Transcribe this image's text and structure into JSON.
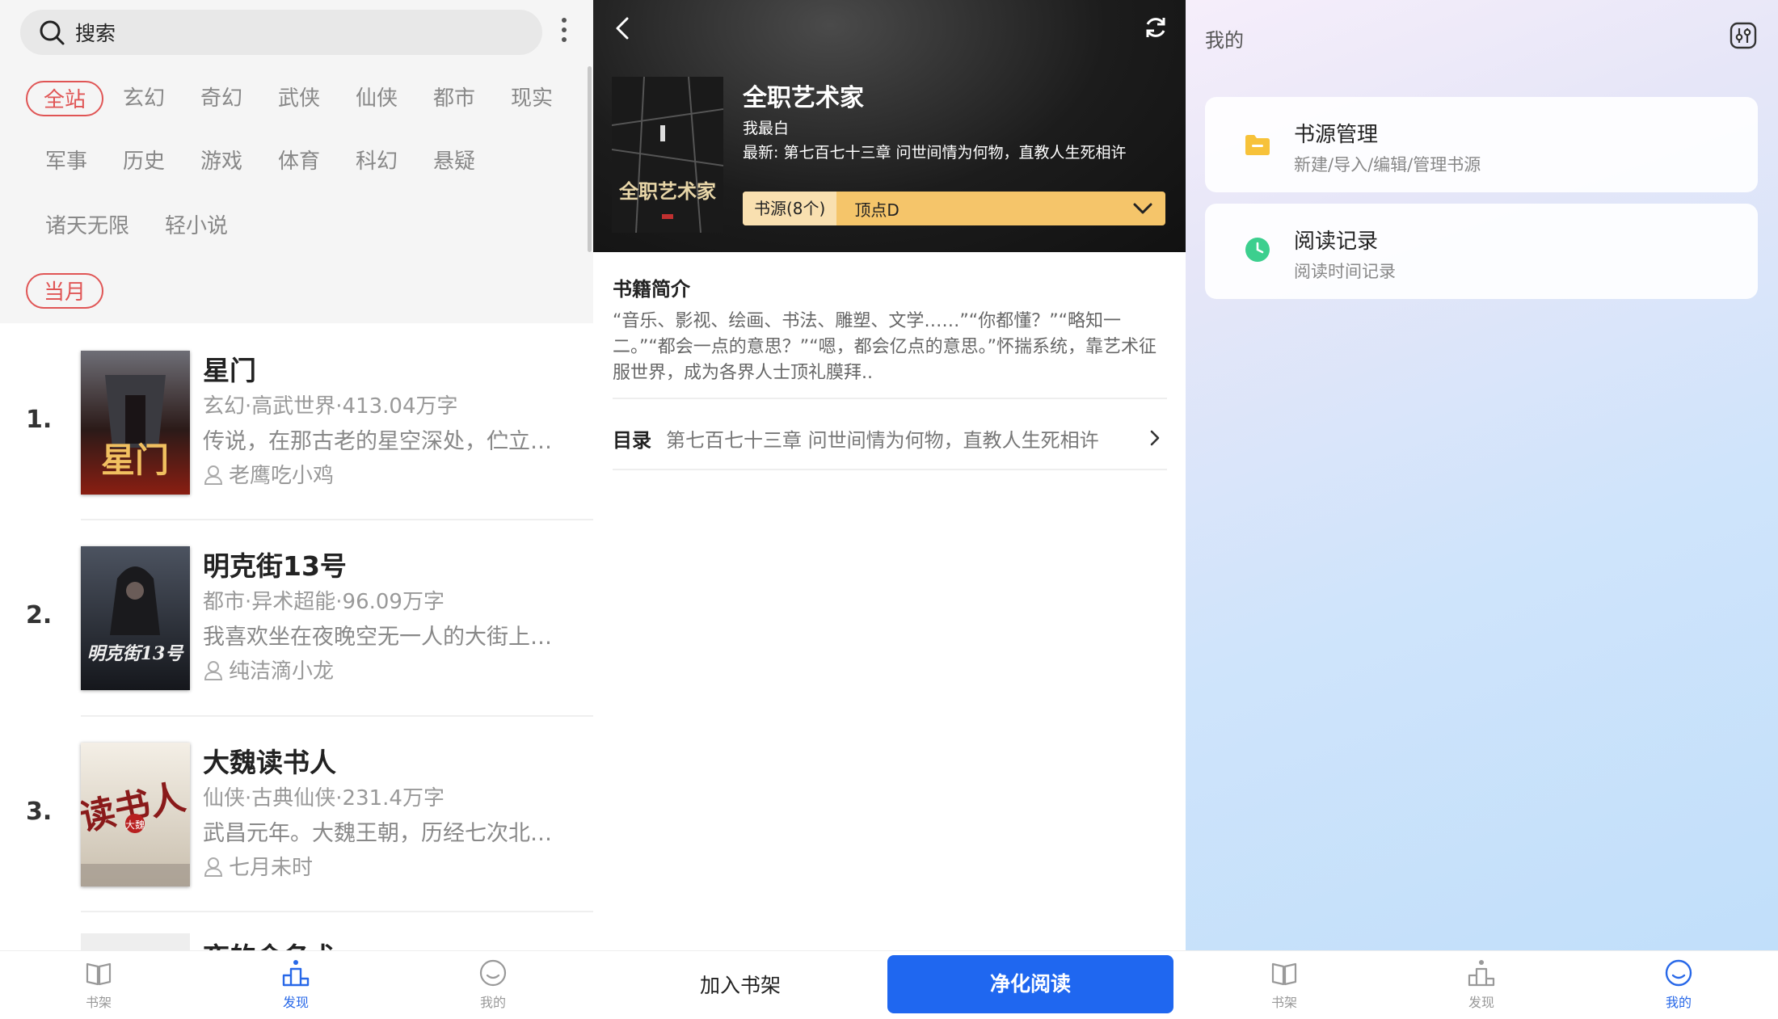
{
  "discover": {
    "search_label": "搜索",
    "categories_row1": [
      "全站",
      "玄幻",
      "奇幻",
      "武侠",
      "仙侠",
      "都市",
      "现实"
    ],
    "categories_row2": [
      "军事",
      "历史",
      "游戏",
      "体育",
      "科幻",
      "悬疑"
    ],
    "categories_row3": [
      "诸天无限",
      "轻小说"
    ],
    "period": "当月",
    "books": [
      {
        "rank": "1.",
        "title": "星门",
        "meta": "玄幻·高武世界·413.04万字",
        "desc": "传说，在那古老的星空深处，伫立…",
        "author": "老鹰吃小鸡"
      },
      {
        "rank": "2.",
        "title": "明克街13号",
        "meta": "都市·异术超能·96.09万字",
        "desc": "我喜欢坐在夜晚空无一人的大街上…",
        "author": "纯洁滴小龙"
      },
      {
        "rank": "3.",
        "title": "大魏读书人",
        "meta": "仙侠·古典仙侠·231.4万字",
        "desc": "武昌元年。大魏王朝，历经七次北…",
        "author": "七月未时"
      }
    ],
    "partial_title": "夜的命名术",
    "cover_texts": {
      "b1": "星门",
      "b2": "明克街13号",
      "b3": "读书人",
      "b3b": "大魏"
    }
  },
  "detail": {
    "title": "全职艺术家",
    "author": "我最白",
    "latest": "最新: 第七百七十三章 问世间情为何物，直教人生死相许",
    "cover_text": "全职艺术家",
    "source_count": "书源(8个)",
    "source_name": "顶点D",
    "intro_title": "书籍简介",
    "intro": "“音乐、影视、绘画、书法、雕塑、文学……”“你都懂？”“略知一二。”“都会一点的意思？”“嗯，都会亿点的意思。”怀揣系统，靠艺术征服世界，成为各界人士顶礼膜拜..",
    "toc_label": "目录",
    "toc_chapter": "第七百七十三章 问世间情为何物，直教人生死相许",
    "add_shelf": "加入书架",
    "pure_read": "净化阅读"
  },
  "mine": {
    "title": "我的",
    "cards": [
      {
        "title": "书源管理",
        "desc": "新建/导入/编辑/管理书源",
        "icon": "folder-icon",
        "color": "#f7c23a"
      },
      {
        "title": "阅读记录",
        "desc": "阅读时间记录",
        "icon": "clock-icon",
        "color": "#3ccf8e"
      }
    ]
  },
  "nav": {
    "shelf": "书架",
    "discover": "发现",
    "mine": "我的"
  },
  "colors": {
    "accent": "#2868e8",
    "category_selected": "#e05555",
    "source_bar": "#f5c56a",
    "primary_button": "#1f67f0"
  }
}
